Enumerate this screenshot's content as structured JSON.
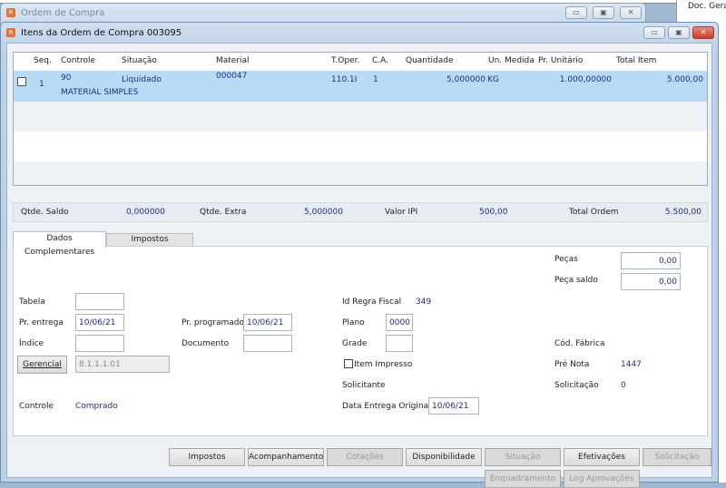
{
  "background_window": {
    "title": "Ordem de Compra",
    "right_panel_text": "Doc. Gerac"
  },
  "window": {
    "title": "Itens da Ordem de Compra 003095"
  },
  "grid": {
    "columns": [
      "Seq.",
      "Controle",
      "Situação",
      "Material",
      "T.Oper.",
      "C.A.",
      "Quantidade",
      "Un. Medida",
      "Pr. Unitário",
      "Total Item"
    ],
    "rows": [
      {
        "checked": false,
        "seq": "1",
        "controle": "90",
        "situacao": "Liquidado",
        "material": "000047",
        "material_desc": "MATERIAL SIMPLES",
        "toper": "110.1I",
        "ca": "1",
        "quantidade": "5,000000",
        "un_medida": "KG",
        "pr_unitario": "1.000,00000",
        "total_item": "5.000,00"
      }
    ]
  },
  "summary": {
    "qtde_saldo_label": "Qtde. Saldo",
    "qtde_saldo": "0,000000",
    "qtde_extra_label": "Qtde. Extra",
    "qtde_extra": "5,000000",
    "valor_ipi_label": "Valor IPI",
    "valor_ipi": "500,00",
    "total_ordem_label": "Total Ordem",
    "total_ordem": "5.500,00"
  },
  "tabs": [
    "Dados Complementares",
    "Impostos"
  ],
  "form": {
    "pecas_label": "Peças",
    "pecas": "0,00",
    "peca_saldo_label": "Peça saldo",
    "peca_saldo": "0,00",
    "tabela_label": "Tabela",
    "tabela": "",
    "id_regra_label": "Id Regra Fiscal",
    "id_regra": "349",
    "pr_entrega_label": "Pr. entrega",
    "pr_entrega": "10/06/21",
    "pr_programado_label": "Pr. programado",
    "pr_programado": "10/06/21",
    "plano_label": "Plano",
    "plano": "0000",
    "indice_label": "Índice",
    "indice": "",
    "documento_label": "Documento",
    "documento": "",
    "grade_label": "Grade",
    "grade": "",
    "cod_fabrica_label": "Cód. Fábrica",
    "gerencial_button": "Gerencial",
    "gerencial": "8.1.1.1.01",
    "item_impresso_label": "Item Impresso",
    "item_impresso": false,
    "pre_nota_label": "Pré Nota",
    "pre_nota": "1447",
    "solicitante_label": "Solicitante",
    "solicitacao_label": "Solicitação",
    "solicitacao": "0",
    "controle_label": "Controle",
    "controle": "Comprado",
    "data_entrega_label": "Data Entrega Original",
    "data_entrega": "10/06/21"
  },
  "buttons": [
    "Impostos",
    "Acompanhamento",
    "Cotações",
    "Disponibilidade",
    "Situação",
    "Efetivações",
    "Solicitação",
    "Enquadramento",
    "Log Aprovações"
  ]
}
